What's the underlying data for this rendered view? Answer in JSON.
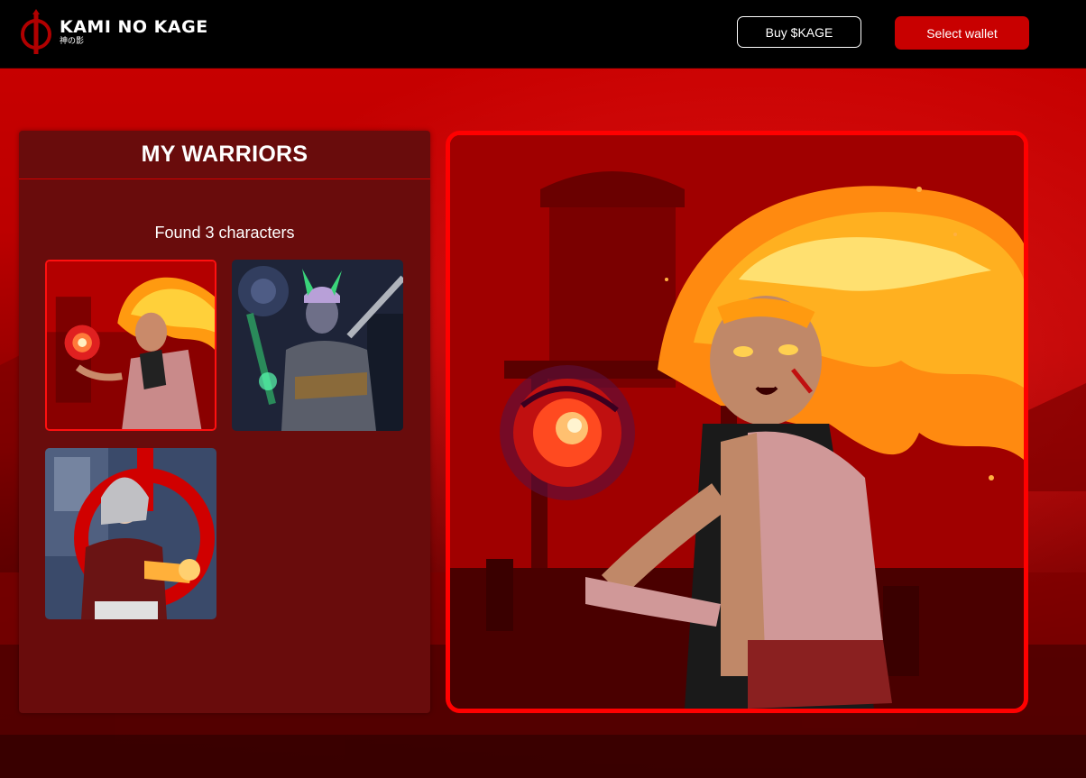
{
  "header": {
    "logo_title": "KAMI NO KAGE",
    "logo_subtitle": "神の影",
    "buy_label": "Buy $KAGE",
    "wallet_label": "Select wallet"
  },
  "warriors_panel": {
    "title": "MY WARRIORS",
    "found_text": "Found 3 characters",
    "characters": [
      {
        "name": "fire-mage-warrior",
        "selected": true
      },
      {
        "name": "horned-swordsman-warrior",
        "selected": false
      },
      {
        "name": "silver-hair-fighter-warrior",
        "selected": false
      }
    ]
  },
  "colors": {
    "accent": "#c80000",
    "panel_bg": "#690c0c",
    "header_bg": "#000000",
    "selection_border": "#ff1010"
  }
}
